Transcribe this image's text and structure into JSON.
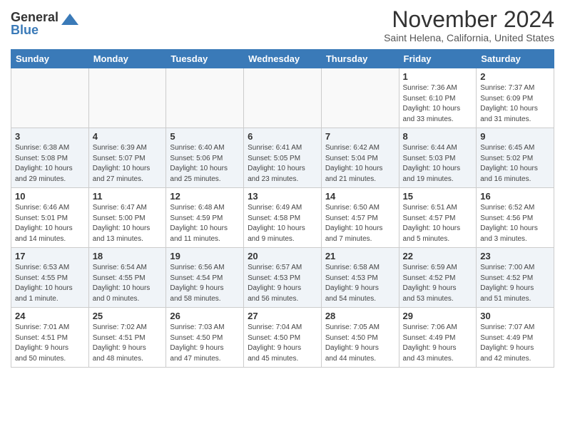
{
  "header": {
    "logo_general": "General",
    "logo_blue": "Blue",
    "month_title": "November 2024",
    "location": "Saint Helena, California, United States"
  },
  "days_of_week": [
    "Sunday",
    "Monday",
    "Tuesday",
    "Wednesday",
    "Thursday",
    "Friday",
    "Saturday"
  ],
  "weeks": [
    [
      {
        "day": "",
        "info": ""
      },
      {
        "day": "",
        "info": ""
      },
      {
        "day": "",
        "info": ""
      },
      {
        "day": "",
        "info": ""
      },
      {
        "day": "",
        "info": ""
      },
      {
        "day": "1",
        "info": "Sunrise: 7:36 AM\nSunset: 6:10 PM\nDaylight: 10 hours\nand 33 minutes."
      },
      {
        "day": "2",
        "info": "Sunrise: 7:37 AM\nSunset: 6:09 PM\nDaylight: 10 hours\nand 31 minutes."
      }
    ],
    [
      {
        "day": "3",
        "info": "Sunrise: 6:38 AM\nSunset: 5:08 PM\nDaylight: 10 hours\nand 29 minutes."
      },
      {
        "day": "4",
        "info": "Sunrise: 6:39 AM\nSunset: 5:07 PM\nDaylight: 10 hours\nand 27 minutes."
      },
      {
        "day": "5",
        "info": "Sunrise: 6:40 AM\nSunset: 5:06 PM\nDaylight: 10 hours\nand 25 minutes."
      },
      {
        "day": "6",
        "info": "Sunrise: 6:41 AM\nSunset: 5:05 PM\nDaylight: 10 hours\nand 23 minutes."
      },
      {
        "day": "7",
        "info": "Sunrise: 6:42 AM\nSunset: 5:04 PM\nDaylight: 10 hours\nand 21 minutes."
      },
      {
        "day": "8",
        "info": "Sunrise: 6:44 AM\nSunset: 5:03 PM\nDaylight: 10 hours\nand 19 minutes."
      },
      {
        "day": "9",
        "info": "Sunrise: 6:45 AM\nSunset: 5:02 PM\nDaylight: 10 hours\nand 16 minutes."
      }
    ],
    [
      {
        "day": "10",
        "info": "Sunrise: 6:46 AM\nSunset: 5:01 PM\nDaylight: 10 hours\nand 14 minutes."
      },
      {
        "day": "11",
        "info": "Sunrise: 6:47 AM\nSunset: 5:00 PM\nDaylight: 10 hours\nand 13 minutes."
      },
      {
        "day": "12",
        "info": "Sunrise: 6:48 AM\nSunset: 4:59 PM\nDaylight: 10 hours\nand 11 minutes."
      },
      {
        "day": "13",
        "info": "Sunrise: 6:49 AM\nSunset: 4:58 PM\nDaylight: 10 hours\nand 9 minutes."
      },
      {
        "day": "14",
        "info": "Sunrise: 6:50 AM\nSunset: 4:57 PM\nDaylight: 10 hours\nand 7 minutes."
      },
      {
        "day": "15",
        "info": "Sunrise: 6:51 AM\nSunset: 4:57 PM\nDaylight: 10 hours\nand 5 minutes."
      },
      {
        "day": "16",
        "info": "Sunrise: 6:52 AM\nSunset: 4:56 PM\nDaylight: 10 hours\nand 3 minutes."
      }
    ],
    [
      {
        "day": "17",
        "info": "Sunrise: 6:53 AM\nSunset: 4:55 PM\nDaylight: 10 hours\nand 1 minute."
      },
      {
        "day": "18",
        "info": "Sunrise: 6:54 AM\nSunset: 4:55 PM\nDaylight: 10 hours\nand 0 minutes."
      },
      {
        "day": "19",
        "info": "Sunrise: 6:56 AM\nSunset: 4:54 PM\nDaylight: 9 hours\nand 58 minutes."
      },
      {
        "day": "20",
        "info": "Sunrise: 6:57 AM\nSunset: 4:53 PM\nDaylight: 9 hours\nand 56 minutes."
      },
      {
        "day": "21",
        "info": "Sunrise: 6:58 AM\nSunset: 4:53 PM\nDaylight: 9 hours\nand 54 minutes."
      },
      {
        "day": "22",
        "info": "Sunrise: 6:59 AM\nSunset: 4:52 PM\nDaylight: 9 hours\nand 53 minutes."
      },
      {
        "day": "23",
        "info": "Sunrise: 7:00 AM\nSunset: 4:52 PM\nDaylight: 9 hours\nand 51 minutes."
      }
    ],
    [
      {
        "day": "24",
        "info": "Sunrise: 7:01 AM\nSunset: 4:51 PM\nDaylight: 9 hours\nand 50 minutes."
      },
      {
        "day": "25",
        "info": "Sunrise: 7:02 AM\nSunset: 4:51 PM\nDaylight: 9 hours\nand 48 minutes."
      },
      {
        "day": "26",
        "info": "Sunrise: 7:03 AM\nSunset: 4:50 PM\nDaylight: 9 hours\nand 47 minutes."
      },
      {
        "day": "27",
        "info": "Sunrise: 7:04 AM\nSunset: 4:50 PM\nDaylight: 9 hours\nand 45 minutes."
      },
      {
        "day": "28",
        "info": "Sunrise: 7:05 AM\nSunset: 4:50 PM\nDaylight: 9 hours\nand 44 minutes."
      },
      {
        "day": "29",
        "info": "Sunrise: 7:06 AM\nSunset: 4:49 PM\nDaylight: 9 hours\nand 43 minutes."
      },
      {
        "day": "30",
        "info": "Sunrise: 7:07 AM\nSunset: 4:49 PM\nDaylight: 9 hours\nand 42 minutes."
      }
    ]
  ]
}
